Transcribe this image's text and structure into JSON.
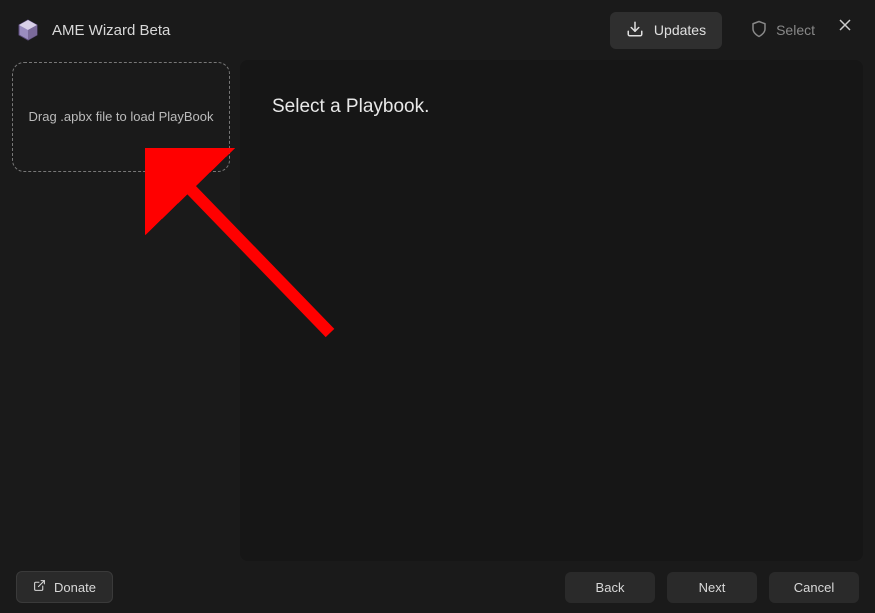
{
  "app": {
    "title": "AME Wizard Beta"
  },
  "titlebar": {
    "updates_label": "Updates",
    "select_label": "Select"
  },
  "sidebar": {
    "dropzone_text": "Drag .apbx file to load PlayBook"
  },
  "main": {
    "heading": "Select a Playbook."
  },
  "footer": {
    "donate_label": "Donate",
    "back_label": "Back",
    "next_label": "Next",
    "cancel_label": "Cancel"
  }
}
